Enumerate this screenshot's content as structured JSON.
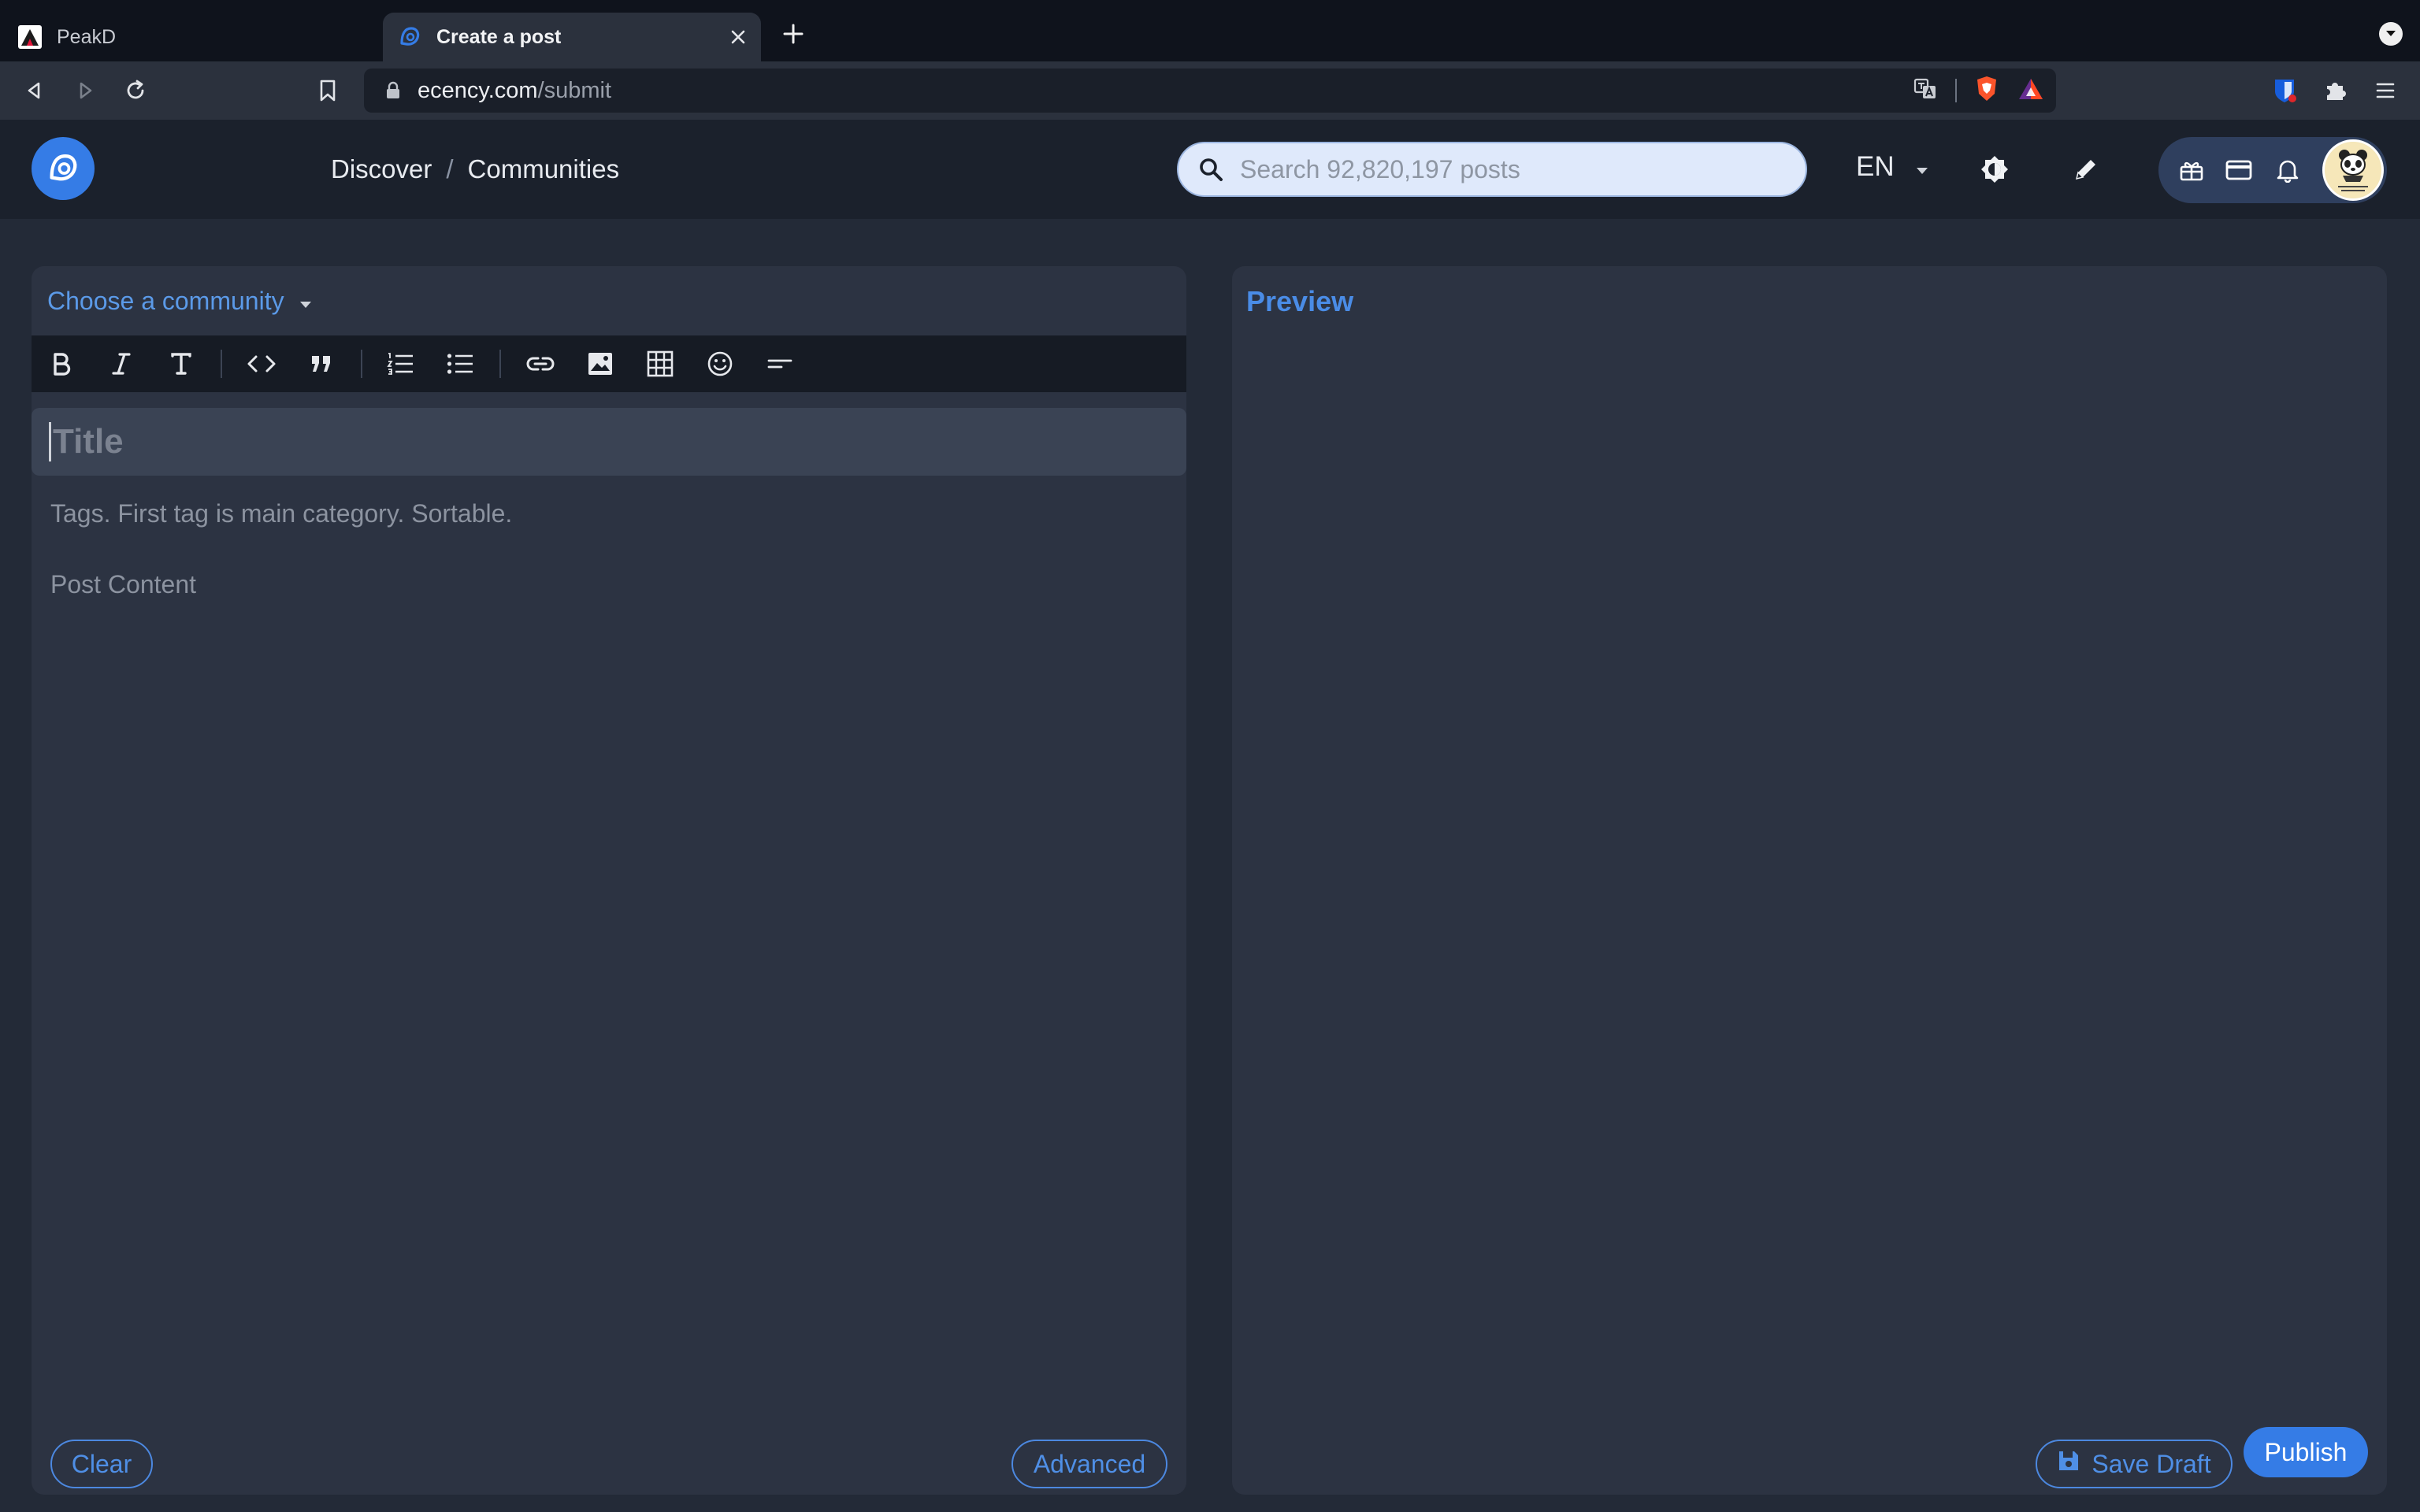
{
  "browser": {
    "tabs": [
      {
        "title": "PeakD",
        "active": false,
        "icon": "peakd-logo-icon"
      },
      {
        "title": "Create a post",
        "active": true,
        "icon": "ecency-logo-icon"
      }
    ],
    "url_host": "ecency.com",
    "url_path": "/submit"
  },
  "header": {
    "nav": {
      "discover": "Discover",
      "separator": "/",
      "communities": "Communities"
    },
    "search_placeholder": "Search 92,820,197 posts",
    "language": "EN"
  },
  "editor": {
    "community_selector": "Choose a community",
    "toolbar_icons": [
      "bold-icon",
      "italic-icon",
      "heading-icon",
      "code-icon",
      "quote-icon",
      "ordered-list-icon",
      "unordered-list-icon",
      "link-icon",
      "image-icon",
      "table-icon",
      "emoji-icon",
      "separator-icon"
    ],
    "title_placeholder": "Title",
    "tags_placeholder": "Tags. First tag is main category. Sortable.",
    "content_placeholder": "Post Content",
    "clear_label": "Clear",
    "advanced_label": "Advanced"
  },
  "preview": {
    "label": "Preview",
    "save_draft_label": "Save Draft",
    "publish_label": "Publish"
  },
  "colors": {
    "accent": "#357ce6",
    "panel": "#2c3342",
    "background": "#232a37",
    "header": "#1b212c"
  }
}
